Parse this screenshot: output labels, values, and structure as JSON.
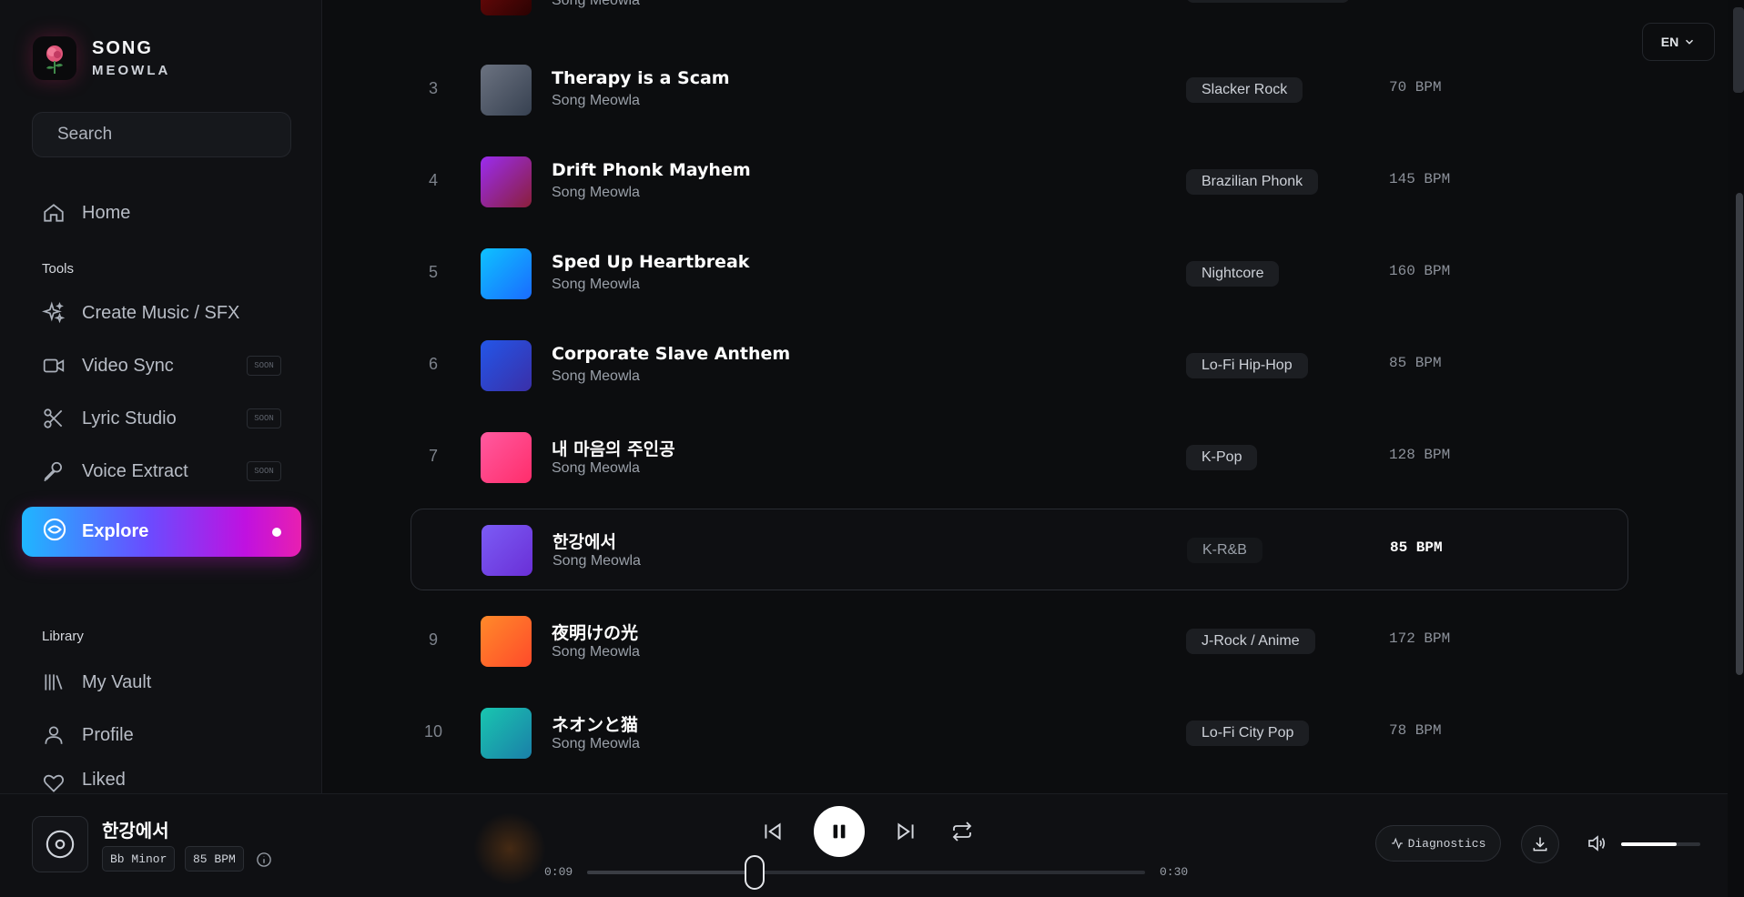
{
  "brand": {
    "line1": "SONG",
    "line2": "MEOWLA"
  },
  "search": {
    "placeholder": "Search"
  },
  "nav": {
    "home": "Home",
    "tools_label": "Tools",
    "create": "Create Music / SFX",
    "video": "Video Sync",
    "lyric": "Lyric Studio",
    "voice": "Voice Extract",
    "soon": "SOON",
    "explore": "Explore",
    "library_label": "Library",
    "vault": "My Vault",
    "profile": "Profile",
    "liked": "Liked"
  },
  "language": {
    "value": "EN"
  },
  "tracks": [
    {
      "num": "",
      "title": "",
      "artist": "Song Meowla",
      "genre": "",
      "bpm": "",
      "color_a": "#7a0a0a",
      "color_b": "#2a0202"
    },
    {
      "num": "3",
      "title": "Therapy is a Scam",
      "artist": "Song Meowla",
      "genre": "Slacker Rock",
      "bpm": "70 BPM",
      "color_a": "#6b7280",
      "color_b": "#374151"
    },
    {
      "num": "4",
      "title": "Drift Phonk Mayhem",
      "artist": "Song Meowla",
      "genre": "Brazilian Phonk",
      "bpm": "145 BPM",
      "color_a": "#9b2cf0",
      "color_b": "#8a1f3a"
    },
    {
      "num": "5",
      "title": "Sped Up Heartbreak",
      "artist": "Song Meowla",
      "genre": "Nightcore",
      "bpm": "160 BPM",
      "color_a": "#0ec2ff",
      "color_b": "#1a6bff"
    },
    {
      "num": "6",
      "title": "Corporate Slave Anthem",
      "artist": "Song Meowla",
      "genre": "Lo-Fi Hip-Hop",
      "bpm": "85 BPM",
      "color_a": "#2356e8",
      "color_b": "#3a2fa8"
    },
    {
      "num": "7",
      "title": "내 마음의 주인공",
      "artist": "Song Meowla",
      "genre": "K-Pop",
      "bpm": "128 BPM",
      "color_a": "#ff5aa0",
      "color_b": "#ff2d6b"
    },
    {
      "num": "",
      "title": "한강에서",
      "artist": "Song Meowla",
      "genre": "K-R&B",
      "bpm": "85 BPM",
      "color_a": "#7b5cf5",
      "color_b": "#6a2fd6"
    },
    {
      "num": "9",
      "title": "夜明けの光",
      "artist": "Song Meowla",
      "genre": "J-Rock / Anime",
      "bpm": "172 BPM",
      "color_a": "#ff8a2a",
      "color_b": "#ff4a2a"
    },
    {
      "num": "10",
      "title": "ネオンと猫",
      "artist": "Song Meowla",
      "genre": "Lo-Fi City Pop",
      "bpm": "78 BPM",
      "color_a": "#19c6b0",
      "color_b": "#1a7fa8"
    }
  ],
  "player": {
    "title": "한강에서",
    "key": "Bb Minor",
    "bpm": "85 BPM",
    "current_time": "0:09",
    "total_time": "0:30",
    "progress_fraction": 0.3,
    "diagnostics": "Diagnostics",
    "volume_fraction": 0.7
  }
}
